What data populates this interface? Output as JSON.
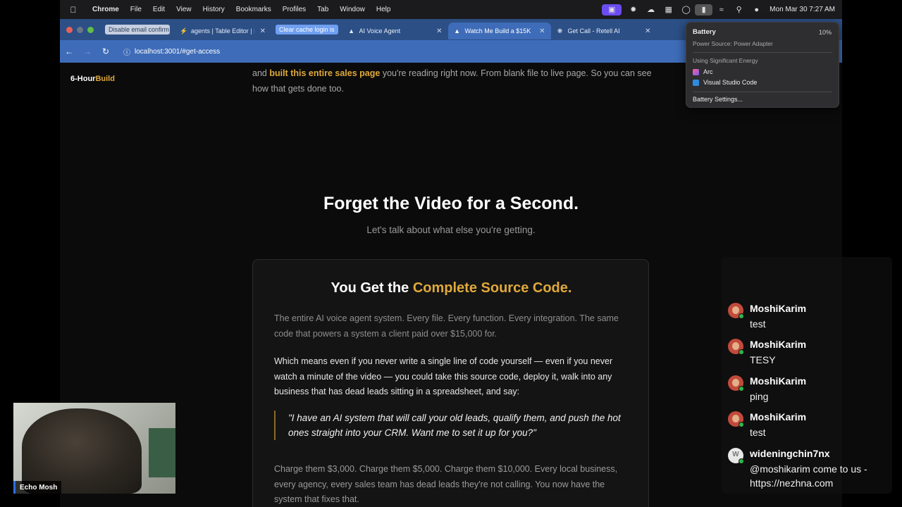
{
  "menubar": {
    "app_name": "Chrome",
    "menus": [
      "File",
      "Edit",
      "View",
      "History",
      "Bookmarks",
      "Profiles",
      "Tab",
      "Window",
      "Help"
    ],
    "clock": "Mon Mar 30  7:27 AM"
  },
  "tabs": [
    {
      "label": "Disable email confirm",
      "kind": "group"
    },
    {
      "label": "agents | Table Editor | R",
      "kind": "tab"
    },
    {
      "label": "Clear cache login is",
      "kind": "group-blue"
    },
    {
      "label": "AI Voice Agent",
      "kind": "tab"
    },
    {
      "label": "Watch Me Build a $15K",
      "kind": "active"
    },
    {
      "label": "Get Call - Retell AI",
      "kind": "tab"
    }
  ],
  "address": {
    "url": "localhost:3001/#get-access"
  },
  "battery_menu": {
    "title": "Battery",
    "percent": "10%",
    "source": "Power Source: Power Adapter",
    "significant_energy": "Using Significant Energy",
    "apps": [
      "Arc",
      "Visual Studio Code"
    ],
    "settings": "Battery Settings..."
  },
  "page": {
    "brand_white": "6-Hour",
    "brand_gold": "Build",
    "intro_pre": "and ",
    "intro_bold": "built this entire sales page",
    "intro_post": " you're reading right now. From blank file to live page. So you can see how that gets done too.",
    "heading": "Forget the Video for a Second.",
    "subheading": "Let's talk about what else you're getting.",
    "card": {
      "title_white": "You Get the ",
      "title_gold": "Complete Source Code.",
      "p1": "The entire AI voice agent system. Every file. Every function. Every integration. The same code that powers a system a client paid over $15,000 for.",
      "p2": "Which means even if you never write a single line of code yourself — even if you never watch a minute of the video — you could take this source code, deploy it, walk into any business that has dead leads sitting in a spreadsheet, and say:",
      "quote": "\"I have an AI system that will call your old leads, qualify them, and push the hot ones straight into your CRM. Want me to set it up for you?\"",
      "p3": "Charge them $3,000. Charge them $5,000. Charge them $10,000. Every local business, every agency, every sales team has dead leads they're not calling. You now have the system that fixes that."
    }
  },
  "webcam": {
    "name": "Echo Mosh"
  },
  "chat": [
    {
      "user": "MoshiKarim",
      "text": "test"
    },
    {
      "user": "MoshiKarim",
      "text": "TESY"
    },
    {
      "user": "MoshiKarim",
      "text": "ping"
    },
    {
      "user": "MoshiKarim",
      "text": "test"
    },
    {
      "user": "wideningchin7nx",
      "text": "@moshikarim come to us - https://nezhna.com"
    }
  ]
}
